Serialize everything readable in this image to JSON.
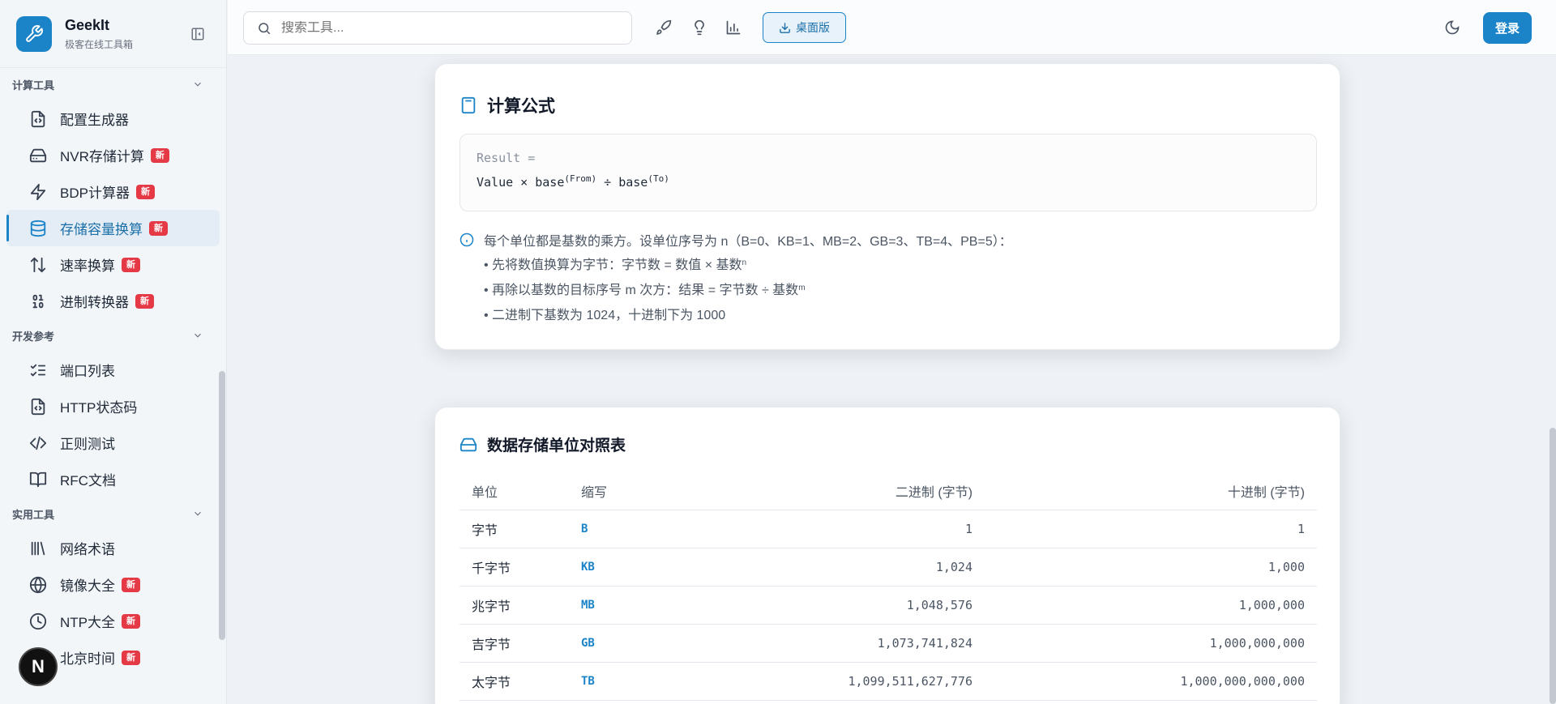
{
  "brand": {
    "name": "GeekIt",
    "subtitle": "极客在线工具箱"
  },
  "search": {
    "placeholder": "搜索工具..."
  },
  "topbar": {
    "desktop_label": "桌面版",
    "login_label": "登录"
  },
  "sidebar": {
    "sections": [
      {
        "title": "计算工具",
        "items": [
          {
            "label": "配置生成器",
            "icon": "file-code-icon",
            "badge": ""
          },
          {
            "label": "NVR存储计算",
            "icon": "hard-drive-icon",
            "badge": "新"
          },
          {
            "label": "BDP计算器",
            "icon": "zap-icon",
            "badge": "新"
          },
          {
            "label": "存储容量换算",
            "icon": "database-icon",
            "badge": "新",
            "active": true
          },
          {
            "label": "速率换算",
            "icon": "arrow-up-down-icon",
            "badge": "新"
          },
          {
            "label": "进制转换器",
            "icon": "binary-icon",
            "badge": "新"
          }
        ]
      },
      {
        "title": "开发参考",
        "items": [
          {
            "label": "端口列表",
            "icon": "list-checks-icon",
            "badge": ""
          },
          {
            "label": "HTTP状态码",
            "icon": "file-code-icon",
            "badge": ""
          },
          {
            "label": "正则测试",
            "icon": "code-icon",
            "badge": ""
          },
          {
            "label": "RFC文档",
            "icon": "book-open-icon",
            "badge": ""
          }
        ]
      },
      {
        "title": "实用工具",
        "items": [
          {
            "label": "网络术语",
            "icon": "library-icon",
            "badge": ""
          },
          {
            "label": "镜像大全",
            "icon": "globe-icon",
            "badge": "新"
          },
          {
            "label": "NTP大全",
            "icon": "clock-icon",
            "badge": "新"
          },
          {
            "label": "北京时间",
            "icon": "clock-icon",
            "badge": "新"
          }
        ]
      }
    ]
  },
  "formula_card": {
    "title": "计算公式",
    "line1": "Result =",
    "line2_a": "Value × base",
    "line2_sup1": "(From)",
    "line2_b": " ÷ base",
    "line2_sup2": "(To)",
    "info": "每个单位都是基数的乘方。设单位序号为 n（B=0、KB=1、MB=2、GB=3、TB=4、PB=5）：",
    "bullet1": "• 先将数值换算为字节：字节数 = 数值 × 基数",
    "bullet1_sup": "n",
    "bullet2": "• 再除以基数的目标序号 m 次方：结果 = 字节数 ÷ 基数",
    "bullet2_sup": "m",
    "bullet3": "• 二进制下基数为 1024，十进制下为 1000"
  },
  "table_card": {
    "title": "数据存储单位对照表",
    "headers": [
      "单位",
      "缩写",
      "二进制 (字节)",
      "十进制 (字节)"
    ],
    "rows": [
      [
        "字节",
        "B",
        "1",
        "1"
      ],
      [
        "千字节",
        "KB",
        "1,024",
        "1,000"
      ],
      [
        "兆字节",
        "MB",
        "1,048,576",
        "1,000,000"
      ],
      [
        "吉字节",
        "GB",
        "1,073,741,824",
        "1,000,000,000"
      ],
      [
        "太字节",
        "TB",
        "1,099,511,627,776",
        "1,000,000,000,000"
      ]
    ]
  },
  "floating": {
    "label": "N"
  },
  "colors": {
    "accent": "#1b84c8",
    "badge": "#e53945"
  }
}
